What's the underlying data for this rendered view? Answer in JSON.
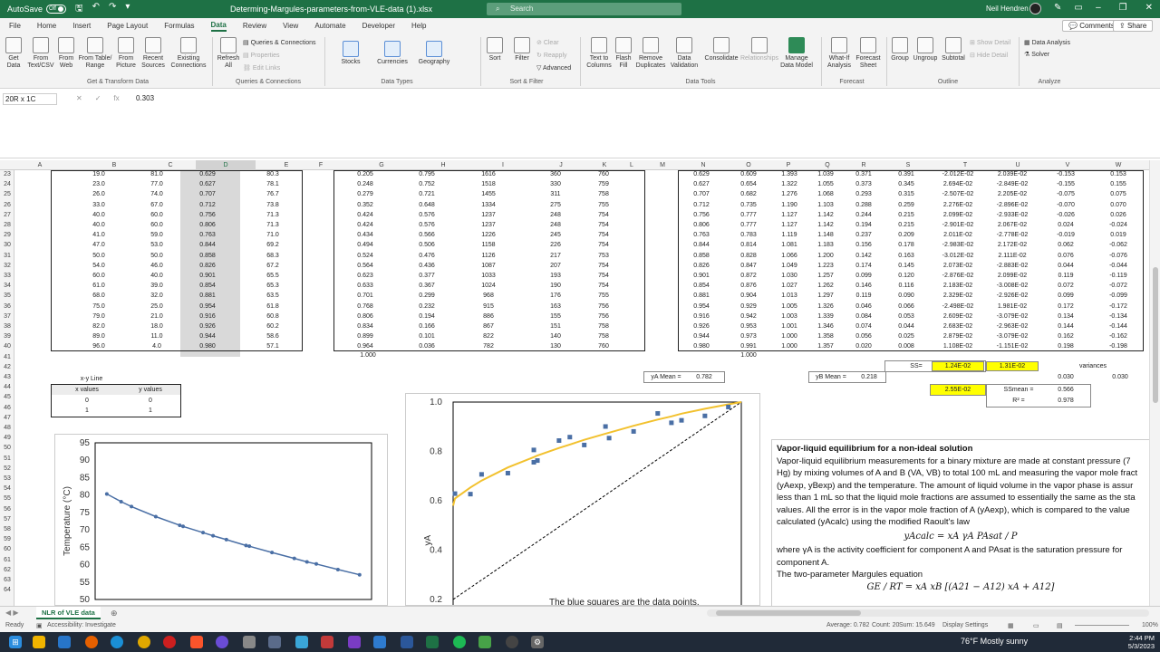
{
  "titlebar": {
    "autosave_label": "AutoSave",
    "autosave_state": "Off",
    "filename": "Determing-Margules-parameters-from-VLE-data (1).xlsx",
    "search_placeholder": "Search",
    "user": "Neil Hendren"
  },
  "menu": {
    "tabs": [
      "File",
      "Home",
      "Insert",
      "Page Layout",
      "Formulas",
      "Data",
      "Review",
      "View",
      "Automate",
      "Developer",
      "Help"
    ],
    "active": "Data",
    "comments": "Comments",
    "share": "Share"
  },
  "ribbon": {
    "get_data": "Get\nData",
    "from_text": "From\nText/CSV",
    "from_web": "From\nWeb",
    "from_table": "From Table/\nRange",
    "from_picture": "From\nPicture",
    "recent_sources": "Recent\nSources",
    "existing_connections": "Existing\nConnections",
    "group_get": "Get & Transform Data",
    "refresh_all": "Refresh\nAll",
    "queries_connections": "Queries & Connections",
    "properties": "Properties",
    "edit_links": "Edit Links",
    "group_queries": "Queries & Connections",
    "stocks": "Stocks",
    "currencies": "Currencies",
    "geography": "Geography",
    "group_datatypes": "Data Types",
    "sort": "Sort",
    "filter": "Filter",
    "clear": "Clear",
    "reapply": "Reapply",
    "advanced": "Advanced",
    "group_sortfilter": "Sort & Filter",
    "text_to_columns": "Text to\nColumns",
    "flash_fill": "Flash\nFill",
    "remove_duplicates": "Remove\nDuplicates",
    "data_validation": "Data\nValidation",
    "consolidate": "Consolidate",
    "relationships": "Relationships",
    "manage_data_model": "Manage\nData Model",
    "group_datatools": "Data Tools",
    "what_if": "What-If\nAnalysis",
    "forecast_sheet": "Forecast\nSheet",
    "group_forecast": "Forecast",
    "group": "Group",
    "ungroup": "Ungroup",
    "subtotal": "Subtotal",
    "show_detail": "Show Detail",
    "hide_detail": "Hide Detail",
    "group_outline": "Outline",
    "data_analysis": "Data Analysis",
    "solver": "Solver",
    "group_analyze": "Analyze"
  },
  "formula": {
    "namebox": "20R x 1C",
    "value": "0.303"
  },
  "columns": [
    "A",
    "B",
    "C",
    "D",
    "E",
    "F",
    "G",
    "H",
    "I",
    "J",
    "K",
    "L",
    "M",
    "N",
    "O",
    "P",
    "Q",
    "R",
    "S",
    "T",
    "U",
    "V",
    "W"
  ],
  "rows": [
    "23",
    "24",
    "25",
    "26",
    "27",
    "28",
    "29",
    "30",
    "31",
    "32",
    "33",
    "34",
    "35",
    "36",
    "37",
    "38",
    "39",
    "40",
    "41",
    "42",
    "43",
    "44",
    "45",
    "46",
    "47",
    "48",
    "49",
    "50",
    "51",
    "52",
    "53",
    "54",
    "55",
    "56",
    "57",
    "58",
    "59",
    "60",
    "61",
    "62",
    "63",
    "64"
  ],
  "table": [
    [
      "19.0",
      "81.0",
      "0.629",
      "80.3",
      "0.205",
      "0.795",
      "1616",
      "360",
      "760",
      "0.629",
      "0.609",
      "1.393",
      "1.039",
      "0.371",
      "0.391",
      "-2.012E-02",
      "2.039E-02",
      "-0.153",
      "0.153"
    ],
    [
      "23.0",
      "77.0",
      "0.627",
      "78.1",
      "0.248",
      "0.752",
      "1518",
      "330",
      "759",
      "0.627",
      "0.654",
      "1.322",
      "1.055",
      "0.373",
      "0.345",
      "2.694E-02",
      "-2.849E-02",
      "-0.155",
      "0.155"
    ],
    [
      "26.0",
      "74.0",
      "0.707",
      "76.7",
      "0.279",
      "0.721",
      "1455",
      "311",
      "758",
      "0.707",
      "0.682",
      "1.276",
      "1.068",
      "0.293",
      "0.315",
      "-2.507E-02",
      "2.205E-02",
      "-0.075",
      "0.075"
    ],
    [
      "33.0",
      "67.0",
      "0.712",
      "73.8",
      "0.352",
      "0.648",
      "1334",
      "275",
      "755",
      "0.712",
      "0.735",
      "1.190",
      "1.103",
      "0.288",
      "0.259",
      "2.276E-02",
      "-2.896E-02",
      "-0.070",
      "0.070"
    ],
    [
      "40.0",
      "60.0",
      "0.756",
      "71.3",
      "0.424",
      "0.576",
      "1237",
      "248",
      "754",
      "0.756",
      "0.777",
      "1.127",
      "1.142",
      "0.244",
      "0.215",
      "2.099E-02",
      "-2.933E-02",
      "-0.026",
      "0.026"
    ],
    [
      "40.0",
      "60.0",
      "0.806",
      "71.3",
      "0.424",
      "0.576",
      "1237",
      "248",
      "754",
      "0.806",
      "0.777",
      "1.127",
      "1.142",
      "0.194",
      "0.215",
      "-2.901E-02",
      "2.067E-02",
      "0.024",
      "-0.024"
    ],
    [
      "41.0",
      "59.0",
      "0.763",
      "71.0",
      "0.434",
      "0.566",
      "1226",
      "245",
      "754",
      "0.763",
      "0.783",
      "1.119",
      "1.148",
      "0.237",
      "0.209",
      "2.011E-02",
      "-2.778E-02",
      "-0.019",
      "0.019"
    ],
    [
      "47.0",
      "53.0",
      "0.844",
      "69.2",
      "0.494",
      "0.506",
      "1158",
      "226",
      "754",
      "0.844",
      "0.814",
      "1.081",
      "1.183",
      "0.156",
      "0.178",
      "-2.983E-02",
      "2.172E-02",
      "0.062",
      "-0.062"
    ],
    [
      "50.0",
      "50.0",
      "0.858",
      "68.3",
      "0.524",
      "0.476",
      "1126",
      "217",
      "753",
      "0.858",
      "0.828",
      "1.066",
      "1.200",
      "0.142",
      "0.163",
      "-3.012E-02",
      "2.111E-02",
      "0.076",
      "-0.076"
    ],
    [
      "54.0",
      "46.0",
      "0.826",
      "67.2",
      "0.564",
      "0.436",
      "1087",
      "207",
      "754",
      "0.826",
      "0.847",
      "1.049",
      "1.223",
      "0.174",
      "0.145",
      "2.073E-02",
      "-2.883E-02",
      "0.044",
      "-0.044"
    ],
    [
      "60.0",
      "40.0",
      "0.901",
      "65.5",
      "0.623",
      "0.377",
      "1033",
      "193",
      "754",
      "0.901",
      "0.872",
      "1.030",
      "1.257",
      "0.099",
      "0.120",
      "-2.876E-02",
      "2.099E-02",
      "0.119",
      "-0.119"
    ],
    [
      "61.0",
      "39.0",
      "0.854",
      "65.3",
      "0.633",
      "0.367",
      "1024",
      "190",
      "754",
      "0.854",
      "0.876",
      "1.027",
      "1.262",
      "0.146",
      "0.116",
      "2.183E-02",
      "-3.008E-02",
      "0.072",
      "-0.072"
    ],
    [
      "68.0",
      "32.0",
      "0.881",
      "63.5",
      "0.701",
      "0.299",
      "968",
      "176",
      "755",
      "0.881",
      "0.904",
      "1.013",
      "1.297",
      "0.119",
      "0.090",
      "2.329E-02",
      "-2.926E-02",
      "0.099",
      "-0.099"
    ],
    [
      "75.0",
      "25.0",
      "0.954",
      "61.8",
      "0.768",
      "0.232",
      "915",
      "163",
      "756",
      "0.954",
      "0.929",
      "1.005",
      "1.326",
      "0.046",
      "0.066",
      "-2.498E-02",
      "1.981E-02",
      "0.172",
      "-0.172"
    ],
    [
      "79.0",
      "21.0",
      "0.916",
      "60.8",
      "0.806",
      "0.194",
      "886",
      "155",
      "756",
      "0.916",
      "0.942",
      "1.003",
      "1.339",
      "0.084",
      "0.053",
      "2.609E-02",
      "-3.079E-02",
      "0.134",
      "-0.134"
    ],
    [
      "82.0",
      "18.0",
      "0.926",
      "60.2",
      "0.834",
      "0.166",
      "867",
      "151",
      "758",
      "0.926",
      "0.953",
      "1.001",
      "1.346",
      "0.074",
      "0.044",
      "2.683E-02",
      "-2.963E-02",
      "0.144",
      "-0.144"
    ],
    [
      "89.0",
      "11.0",
      "0.944",
      "58.6",
      "0.899",
      "0.101",
      "822",
      "140",
      "758",
      "0.944",
      "0.973",
      "1.000",
      "1.358",
      "0.056",
      "0.025",
      "2.879E-02",
      "-3.079E-02",
      "0.162",
      "-0.162"
    ],
    [
      "96.0",
      "4.0",
      "0.980",
      "57.1",
      "0.964",
      "0.036",
      "782",
      "130",
      "760",
      "0.980",
      "0.991",
      "1.000",
      "1.357",
      "0.020",
      "0.008",
      "1.108E-02",
      "-1.151E-02",
      "0.198",
      "-0.198"
    ]
  ],
  "extra": {
    "g41": "1.000",
    "o41": "1.000",
    "ss_label": "SS=",
    "ss_t": "1.24E-02",
    "ss_u": "1.31E-02",
    "variances_label": "variances",
    "ya_mean_label": "yA Mean =",
    "ya_mean": "0.782",
    "yb_mean_label": "yB Mean =",
    "yb_mean": "0.218",
    "var_v": "0.030",
    "var_w": "0.030",
    "ss_total": "2.55E-02",
    "ssmean_label": "SSmean =",
    "ssmean": "0.566",
    "r2_label": "R² =",
    "r2": "0.978",
    "xy_line": "x-y Line",
    "xy_headers": [
      "x values",
      "y values"
    ],
    "xy_rows": [
      [
        "0",
        "0"
      ],
      [
        "1",
        "1"
      ]
    ]
  },
  "chart_data": [
    {
      "type": "line",
      "title": "",
      "xlabel": "",
      "ylabel": "Temperature (°C)",
      "ylim": [
        50,
        95
      ],
      "yticks": [
        50,
        55,
        60,
        65,
        70,
        75,
        80,
        85,
        90,
        95
      ],
      "x": [
        0.205,
        0.248,
        0.279,
        0.352,
        0.424,
        0.434,
        0.494,
        0.524,
        0.564,
        0.623,
        0.633,
        0.701,
        0.768,
        0.806,
        0.834,
        0.899,
        0.964
      ],
      "series": [
        {
          "name": "",
          "values": [
            80.3,
            78.1,
            76.7,
            73.8,
            71.3,
            71.0,
            69.2,
            68.3,
            67.2,
            65.5,
            65.3,
            63.5,
            61.8,
            60.8,
            60.2,
            58.6,
            57.1
          ]
        }
      ],
      "color": "#4a6fa5"
    },
    {
      "type": "scatter",
      "title": "",
      "xlabel": "",
      "ylabel": "yA",
      "ylim": [
        0.2,
        1.0
      ],
      "yticks": [
        0.2,
        0.4,
        0.6,
        0.8,
        1.0
      ],
      "xlim": [
        0.2,
        1.0
      ],
      "points": {
        "x": [
          0.205,
          0.248,
          0.279,
          0.352,
          0.424,
          0.424,
          0.434,
          0.494,
          0.524,
          0.564,
          0.623,
          0.633,
          0.701,
          0.768,
          0.806,
          0.834,
          0.899,
          0.964
        ],
        "y": [
          0.629,
          0.627,
          0.707,
          0.712,
          0.756,
          0.806,
          0.763,
          0.844,
          0.858,
          0.826,
          0.901,
          0.854,
          0.881,
          0.954,
          0.916,
          0.926,
          0.944,
          0.98
        ]
      },
      "fit": {
        "x": [
          0.205,
          0.248,
          0.279,
          0.352,
          0.424,
          0.434,
          0.494,
          0.524,
          0.564,
          0.623,
          0.633,
          0.701,
          0.768,
          0.806,
          0.834,
          0.899,
          0.964
        ],
        "y": [
          0.609,
          0.654,
          0.682,
          0.735,
          0.777,
          0.783,
          0.814,
          0.828,
          0.847,
          0.872,
          0.876,
          0.904,
          0.929,
          0.942,
          0.953,
          0.973,
          0.991
        ]
      },
      "diagonal": [
        [
          0,
          0
        ],
        [
          1,
          1
        ]
      ],
      "annotation": "The blue squares are the  data points.",
      "point_color": "#4a6fa5",
      "fit_color": "#f2c12e"
    }
  ],
  "notes": {
    "heading": "Vapor-liquid equilibrium for a non-ideal solution",
    "lines": [
      "Vapor-liquid equilibrium measurements for a binary mixture are made at constant pressure (7",
      "Hg) by mixing volumes of A and B (VA, VB) to total 100 mL and measuring the vapor mole fract",
      "(yAexp, yBexp) and the temperature. The amount of liquid volume in the vapor phase is assur",
      "less than 1 mL so that the liquid mole fractions are assumed to essentially the same as the sta",
      "values. All the error is in the vapor mole fraction of A (yAexp), which is compared to the value",
      "calculated (yAcalc) using the modified Raoult's law"
    ],
    "eq1": "yAcalc = xA γA PAsat / P",
    "line_after1": "where γA is the activity coefficient for component A and PAsat is the saturation pressure for",
    "line_after2": "component A.",
    "line_after3": "The two-parameter Margules equation",
    "eq2": "GE / RT = xA xB [(A21 − A12) xA + A12]"
  },
  "sheet_tab": "NLR of VLE data",
  "status": {
    "ready": "Ready",
    "accessibility": "Accessibility: Investigate",
    "average": "Average: 0.782",
    "count": "Count: 20",
    "sum": "Sum: 15.649",
    "display": "Display Settings",
    "zoom": "100%"
  },
  "taskbar": {
    "weather": "76°F  Mostly sunny",
    "time": "2:44 PM",
    "date": "5/3/2023"
  }
}
